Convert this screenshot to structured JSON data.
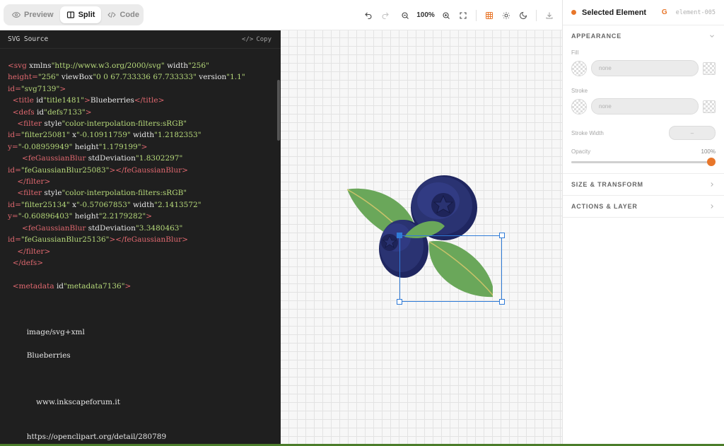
{
  "toolbar": {
    "modes": [
      {
        "label": "Preview",
        "icon": "eye-icon"
      },
      {
        "label": "Split",
        "icon": "split-icon",
        "active": true
      },
      {
        "label": "Code",
        "icon": "code-icon"
      }
    ],
    "zoom": "100%"
  },
  "code_panel": {
    "title": "SVG Source",
    "copy_label": "Copy",
    "lines": [
      {
        "text": "<svg xmlns=\"http://www.w3.org/2000/svg\" width=\"256\"",
        "kind": "tag"
      },
      {
        "text": "height=\"256\" viewBox=\"0 0 67.733336 67.733333\" version=\"1.1\"",
        "kind": "tag"
      },
      {
        "text": "id=\"svg7139\">",
        "kind": "tag"
      },
      {
        "text": "  <title id=\"title1481\">Blueberries</title>",
        "kind": "tag"
      },
      {
        "text": "  <defs id=\"defs7133\">",
        "kind": "tag"
      },
      {
        "text": "    <filter style=\"color-interpolation-filters:sRGB\"",
        "kind": "tag"
      },
      {
        "text": "id=\"filter25081\" x=\"-0.10911759\" width=\"1.2182353\"",
        "kind": "tag"
      },
      {
        "text": "y=\"-0.08959949\" height=\"1.179199\">",
        "kind": "tag"
      },
      {
        "text": "      <feGaussianBlur stdDeviation=\"1.8302297\"",
        "kind": "tag"
      },
      {
        "text": "id=\"feGaussianBlur25083\"></feGaussianBlur>",
        "kind": "tag"
      },
      {
        "text": "    </filter>",
        "kind": "tag"
      },
      {
        "text": "    <filter style=\"color-interpolation-filters:sRGB\"",
        "kind": "tag"
      },
      {
        "text": "id=\"filter25134\" x=\"-0.57067853\" width=\"2.1413572\"",
        "kind": "tag"
      },
      {
        "text": "y=\"-0.60896403\" height=\"2.2179282\">",
        "kind": "tag"
      },
      {
        "text": "      <feGaussianBlur stdDeviation=\"3.3480463\"",
        "kind": "tag"
      },
      {
        "text": "id=\"feGaussianBlur25136\"></feGaussianBlur>",
        "kind": "tag"
      },
      {
        "text": "    </filter>",
        "kind": "tag"
      },
      {
        "text": "  </defs>",
        "kind": "tag"
      },
      {
        "text": "",
        "kind": "blank"
      },
      {
        "text": "  <metadata id=\"metadata7136\">",
        "kind": "tag"
      },
      {
        "text": "",
        "kind": "blank"
      },
      {
        "text": "",
        "kind": "blank"
      },
      {
        "text": "",
        "kind": "blank"
      },
      {
        "text": "        image/svg+xml",
        "kind": "text"
      },
      {
        "text": "",
        "kind": "blank"
      },
      {
        "text": "        Blueberries",
        "kind": "text"
      },
      {
        "text": "",
        "kind": "blank"
      },
      {
        "text": "",
        "kind": "blank"
      },
      {
        "text": "",
        "kind": "blank"
      },
      {
        "text": "            www.inkscapeforum.it",
        "kind": "text"
      },
      {
        "text": "",
        "kind": "blank"
      },
      {
        "text": "",
        "kind": "blank"
      },
      {
        "text": "        https://openclipart.org/detail/280789",
        "kind": "text"
      }
    ]
  },
  "inspector": {
    "title": "Selected Element",
    "element_type": "G",
    "element_id": "element-005",
    "sections": {
      "appearance": "APPEARANCE",
      "size_transform": "SIZE & TRANSFORM",
      "actions_layer": "ACTIONS & LAYER"
    },
    "fill_label": "Fill",
    "fill_value": "none",
    "stroke_label": "Stroke",
    "stroke_value": "none",
    "stroke_width_label": "Stroke Width",
    "stroke_width_value": "–",
    "opacity_label": "Opacity",
    "opacity_value": "100%",
    "opacity_fraction": 1.0
  },
  "colors": {
    "accent": "#e8762a",
    "selection": "#2f7bd8",
    "leaf": "#6aa75a",
    "berry": "#2a3372"
  }
}
